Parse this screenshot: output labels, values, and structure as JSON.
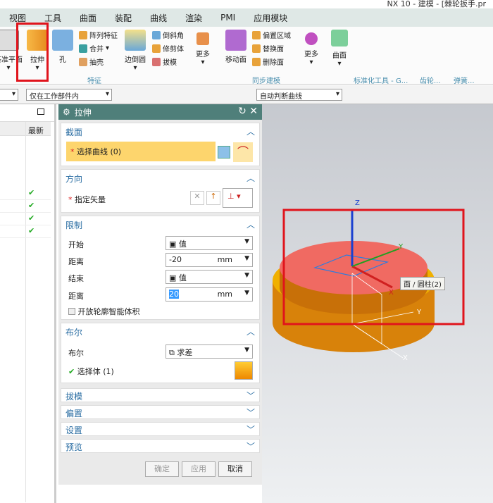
{
  "window": {
    "title": "NX 10 - 建模 - [棘轮扳手.pr"
  },
  "tabs": [
    "视图",
    "工具",
    "曲面",
    "装配",
    "曲线",
    "渲染",
    "PMI",
    "应用模块"
  ],
  "ribbon": {
    "datum_plane": "基准平面",
    "extrude": "拉伸",
    "hole": "孔",
    "pattern": "阵列特征",
    "unite": "合并",
    "shell": "抽壳",
    "edge_blend": "边倒圆",
    "chamfer": "倒斜角",
    "trim_body": "修剪体",
    "draft": "拔模",
    "more1": "更多",
    "move_face": "移动面",
    "offset_region": "偏置区域",
    "replace_face": "替换面",
    "delete_face": "删除面",
    "more2": "更多",
    "surface": "曲面",
    "groups": {
      "feature": "特征",
      "sync": "同步建模",
      "std_tools": "标准化工具 - G...",
      "gear": "齿轮...",
      "spring": "弹簧..."
    }
  },
  "toolbar": {
    "scope": "仅在工作部件内",
    "curve_rule": "自动判断曲线"
  },
  "navigator": {
    "col_latest": "最新",
    "checks": [
      "✔",
      "✔",
      "✔",
      "✔"
    ]
  },
  "dialog": {
    "title": "拉伸",
    "section": {
      "title": "截面",
      "select_curve": "选择曲线 (0)"
    },
    "direction": {
      "title": "方向",
      "specify_vector": "指定矢量"
    },
    "limits": {
      "title": "限制",
      "start": "开始",
      "start_val": "值",
      "dist1": "距离",
      "dist1_val": "-20",
      "end": "结束",
      "end_val": "值",
      "dist2": "距离",
      "dist2_val": "20",
      "unit": "mm",
      "open_profile": "开放轮廓智能体积"
    },
    "boolean": {
      "title": "布尔",
      "label": "布尔",
      "value": "求差",
      "select_body": "选择体 (1)"
    },
    "collapsed": [
      "拔模",
      "偏置",
      "设置",
      "预览"
    ],
    "ok": "确定",
    "apply": "应用",
    "cancel": "取消"
  },
  "viewport": {
    "tooltip": "面 / 圆柱(2)",
    "axes": {
      "z": "Z",
      "y": "Y",
      "x": "X"
    }
  },
  "colors": {
    "highlight": "#e8271f",
    "accent": "#4f7f7a",
    "select": "#fdd56d"
  }
}
